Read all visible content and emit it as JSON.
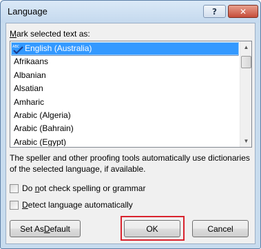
{
  "window": {
    "title": "Language",
    "help_label": "?",
    "close_label": "✕"
  },
  "mark_label_prefix": "M",
  "mark_label_rest": "ark selected text as:",
  "languages": [
    "English (Australia)",
    "Afrikaans",
    "Albanian",
    "Alsatian",
    "Amharic",
    "Arabic (Algeria)",
    "Arabic (Bahrain)",
    "Arabic (Egypt)"
  ],
  "selected_language": "English (Australia)",
  "info_text": "The speller and other proofing tools automatically use dictionaries of the selected language, if available.",
  "checkboxes": {
    "no_check_pre": "Do ",
    "no_check_u": "n",
    "no_check_post": "ot check spelling or grammar",
    "no_check_checked": false,
    "detect_pre": "",
    "detect_u": "D",
    "detect_post": "etect language automatically",
    "detect_checked": false
  },
  "buttons": {
    "default_pre": "Set As ",
    "default_u": "D",
    "default_post": "efault",
    "ok": "OK",
    "cancel": "Cancel"
  },
  "icons": {
    "spell": "spelling-check-icon",
    "scroll_up": "scroll-up-arrow-icon",
    "scroll_down": "scroll-down-arrow-icon"
  },
  "colors": {
    "selection": "#3399ff",
    "highlight": "#d9232d",
    "close_button": "#c64d3a"
  }
}
